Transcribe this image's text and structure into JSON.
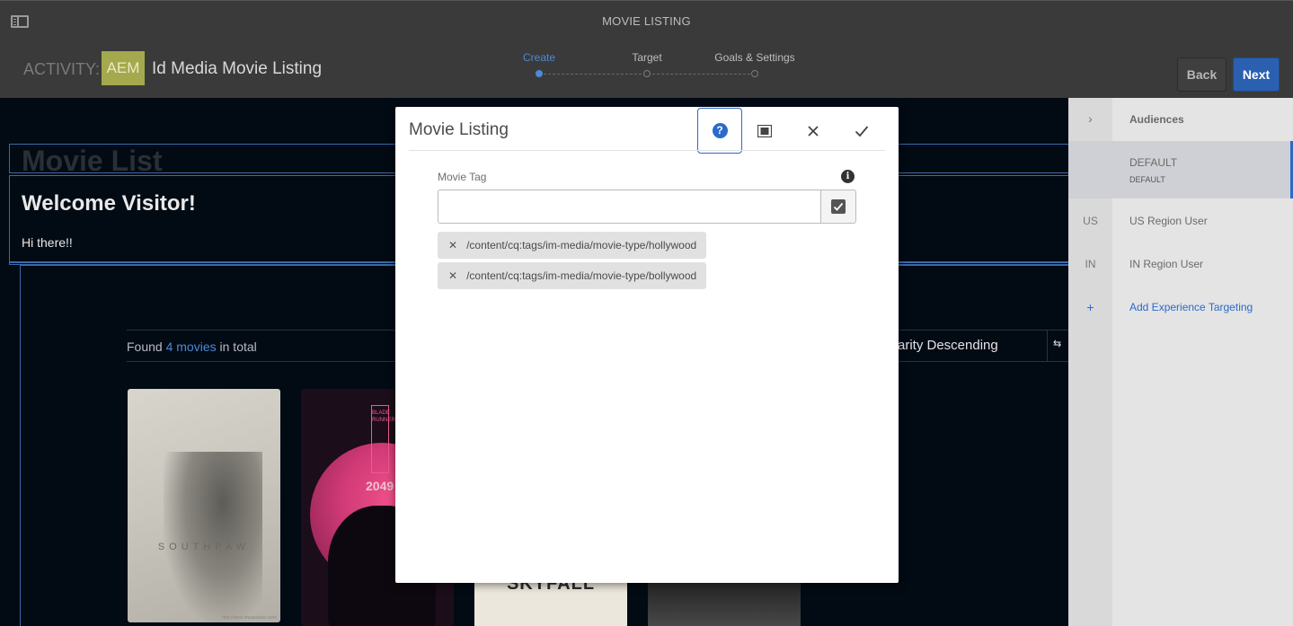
{
  "header": {
    "window_title": "MOVIE LISTING",
    "activity_label": "ACTIVITY:",
    "brand_badge": "AEM",
    "activity_name": "Id Media Movie Listing",
    "steps": [
      {
        "label": "Create",
        "active": true
      },
      {
        "label": "Target",
        "active": false
      },
      {
        "label": "Goals & Settings",
        "active": false
      }
    ],
    "back_label": "Back",
    "next_label": "Next",
    "colors": {
      "bar": "#3a3a3a",
      "accent": "#4b8bd7",
      "next": "#2b5fb0",
      "badge": "#a4a94d"
    }
  },
  "page": {
    "title": "Movie List",
    "welcome": "Welcome Visitor!",
    "greeting": "Hi there!!",
    "found_prefix": "Found",
    "found_link": "4 movies",
    "found_suffix": "in total",
    "sort_label": "arity Descending",
    "posters": [
      {
        "title": "SOUTHPAW",
        "credit": "http://www.impawards.com/"
      },
      {
        "title": "BLADE RUNNER",
        "year": "2049"
      },
      {
        "title": "SKYFALL"
      },
      {
        "title": ""
      }
    ]
  },
  "dialog": {
    "title": "Movie Listing",
    "field_label": "Movie Tag",
    "input_value": "",
    "tags": [
      "/content/cq:tags/im-media/movie-type/hollywood",
      "/content/cq:tags/im-media/movie-type/bollywood"
    ],
    "icons": [
      "help-icon",
      "fullscreen-icon",
      "close-icon",
      "done-icon",
      "info-icon",
      "picker-check-icon"
    ]
  },
  "audiences": {
    "heading": "Audiences",
    "items": [
      {
        "code": "",
        "label": "DEFAULT",
        "sub": "DEFAULT",
        "selected": true
      },
      {
        "code": "US",
        "label": "US Region User",
        "selected": false
      },
      {
        "code": "IN",
        "label": "IN Region User",
        "selected": false
      }
    ],
    "add_label": "Add Experience Targeting",
    "add_symbol": "+"
  }
}
